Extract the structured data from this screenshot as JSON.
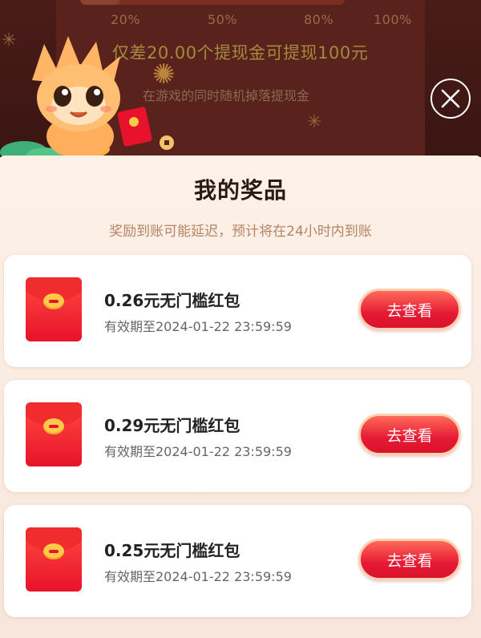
{
  "background": {
    "progress_fraction": 0.15,
    "progress_labels": [
      "20%",
      "50%",
      "80%",
      "100%"
    ],
    "headline": "仅差20.00个提现金可提现100元",
    "subline": "在游戏的同时随机掉落提现金"
  },
  "modal": {
    "title": "我的奖品",
    "subtitle": "奖励到账可能延迟，预计将在24小时内到账"
  },
  "prizes": [
    {
      "title": "0.26元无门槛红包",
      "expiry": "有效期至2024-01-22 23:59:59",
      "button": "去查看"
    },
    {
      "title": "0.29元无门槛红包",
      "expiry": "有效期至2024-01-22 23:59:59",
      "button": "去查看"
    },
    {
      "title": "0.25元无门槛红包",
      "expiry": "有效期至2024-01-22 23:59:59",
      "button": "去查看"
    }
  ],
  "icons": {
    "close": "close-icon",
    "envelope": "red-envelope-icon",
    "mascot": "dragon-mascot",
    "firework": "firework-icon"
  },
  "colors": {
    "accent": "#e8122c",
    "sheet_bg": "#fdf1e8",
    "subtitle": "#b58466"
  }
}
